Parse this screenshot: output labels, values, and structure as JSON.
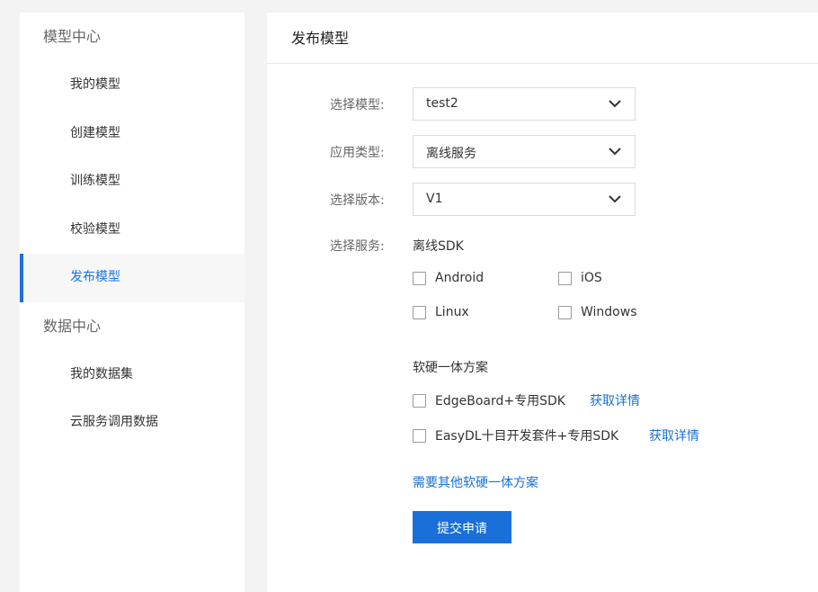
{
  "sidebar": {
    "model_center": "模型中心",
    "model_items": [
      "我的模型",
      "创建模型",
      "训练模型",
      "校验模型",
      "发布模型"
    ],
    "data_center": "数据中心",
    "data_items": [
      "我的数据集",
      "云服务调用数据"
    ]
  },
  "main": {
    "title": "发布模型",
    "select_model_label": "选择模型:",
    "select_model_value": "test2",
    "app_type_label": "应用类型:",
    "app_type_value": "离线服务",
    "version_label": "选择版本:",
    "version_value": "V1",
    "service_label": "选择服务:",
    "offline_sdk": "离线SDK",
    "platforms": [
      "Android",
      "iOS",
      "Linux",
      "Windows"
    ],
    "hw_title": "软硬一体方案",
    "hw_options": [
      "EdgeBoard+专用SDK",
      "EasyDL十目开发套件+专用SDK"
    ],
    "detail_link": "获取详情",
    "other_solutions_link": "需要其他软硬一体方案",
    "submit_label": "提交申请"
  },
  "colors": {
    "accent": "#1a6fd8",
    "active_bar": "#1f6fe0"
  }
}
